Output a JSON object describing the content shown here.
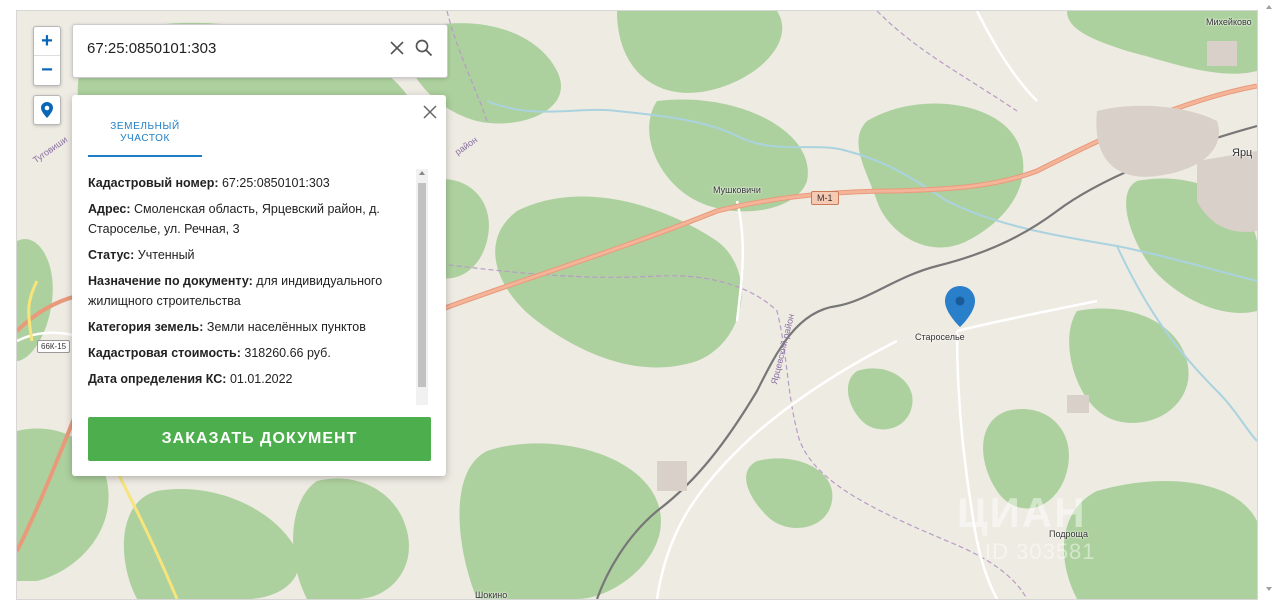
{
  "map": {
    "places": {
      "mikheykovo": "Михейково",
      "yartsevo": "Ярц",
      "mushkovichi": "Мушковичи",
      "staroselye": "Староселье",
      "podroscha": "Подроща",
      "shokino": "Шокино"
    },
    "roads": {
      "m1": "М-1",
      "r66k": "66К-15"
    },
    "districts": {
      "yartsevsky": "Ярцевский район",
      "rayon_top": "район",
      "tugovishi": "Туговиши"
    },
    "watermark": "ЦИАН",
    "watermark_sub": "ID 303581",
    "colors": {
      "background": "#eeebe3",
      "forest": "#add19e",
      "highway": "#f4a686",
      "marker": "#2a7fcb"
    }
  },
  "controls": {
    "zoom_in": "+",
    "zoom_out": "−"
  },
  "search": {
    "value": "67:25:0850101:303",
    "placeholder": ""
  },
  "panel": {
    "tab": "ЗЕМЕЛЬНЫЙ УЧАСТОК",
    "rows": [
      {
        "label": "Кадастровый номер:",
        "value": "67:25:0850101:303"
      },
      {
        "label": "Адрес:",
        "value": "Смоленская область, Ярцевский район, д. Староселье, ул. Речная, 3"
      },
      {
        "label": "Статус:",
        "value": "Учтенный"
      },
      {
        "label": "Назначение по документу:",
        "value": "для индивидуального жилищного строительства"
      },
      {
        "label": "Категория земель:",
        "value": "Земли населённых пунктов"
      },
      {
        "label": "Кадастровая стоимость:",
        "value": "318260.66 руб."
      },
      {
        "label": "Дата определения КС:",
        "value": "01.01.2022"
      }
    ],
    "order_button": "ЗАКАЗАТЬ ДОКУМЕНТ"
  }
}
